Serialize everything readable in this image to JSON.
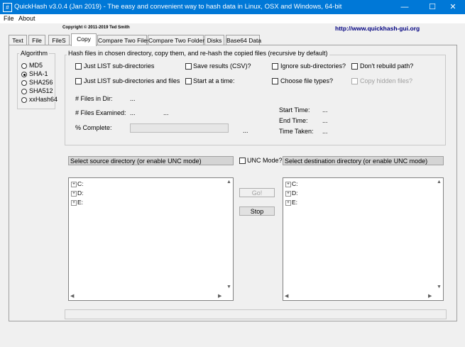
{
  "window": {
    "icon_glyph": "#",
    "title": "QuickHash v3.0.4 (Jan 2019) - The easy and convenient way to hash data in Linux, OSX and Windows, 64-bit",
    "minimize_glyph": "—",
    "maximize_glyph": "☐",
    "close_glyph": "✕"
  },
  "menu": {
    "file": "File",
    "about": "About"
  },
  "header": {
    "copyright": "Copyright © 2011-2019  Ted Smith",
    "url": "http://www.quickhash-gui.org"
  },
  "tabs": [
    "Text",
    "File",
    "FileS",
    "Copy",
    "Compare Two Files",
    "Compare Two Folders",
    "Disks",
    "Base64 Data"
  ],
  "algorithm": {
    "title": "Algorithm",
    "options": [
      "MD5",
      "SHA-1",
      "SHA256",
      "SHA512",
      "xxHash64"
    ],
    "selected": "SHA-1"
  },
  "copy_panel": {
    "group_title": "Hash files in chosen directory, copy them, and re-hash the copied files (recursive by default)",
    "checkboxes": {
      "just_list_subdirs": "Just LIST sub-directories",
      "save_results": "Save results (CSV)?",
      "ignore_subdirs": "Ignore sub-directories?",
      "dont_rebuild_path": "Don't rebuild path?",
      "just_list_subdirs_files": "Just LIST sub-directories and files",
      "start_at_time": "Start at a time:",
      "choose_file_types": "Choose file types?",
      "copy_hidden_files": "Copy hidden files?"
    },
    "stats": {
      "files_in_dir_label": "# Files in Dir:",
      "files_in_dir_value": "...",
      "files_examined_label": "# Files Examined:",
      "files_examined_value": "...",
      "files_examined_value2": "...",
      "percent_complete_label": "% Complete:",
      "percent_complete_value": "...",
      "start_time_label": "Start Time:",
      "start_time_value": "...",
      "end_time_label": "End Time:",
      "end_time_value": "...",
      "time_taken_label": "Time Taken:",
      "time_taken_value": "..."
    },
    "source_header": "Select source directory (or enable UNC mode)",
    "unc_label": "UNC Mode?",
    "dest_header": "Select destination directory (or enable UNC mode)",
    "source_drives": [
      "C:",
      "D:",
      "E:"
    ],
    "dest_drives": [
      "C:",
      "D:",
      "E:"
    ],
    "go_label": "Go!",
    "stop_label": "Stop",
    "expander_glyph": "+",
    "scroll_up": "▲",
    "scroll_down": "▼",
    "scroll_left": "◀",
    "scroll_right": "▶"
  }
}
